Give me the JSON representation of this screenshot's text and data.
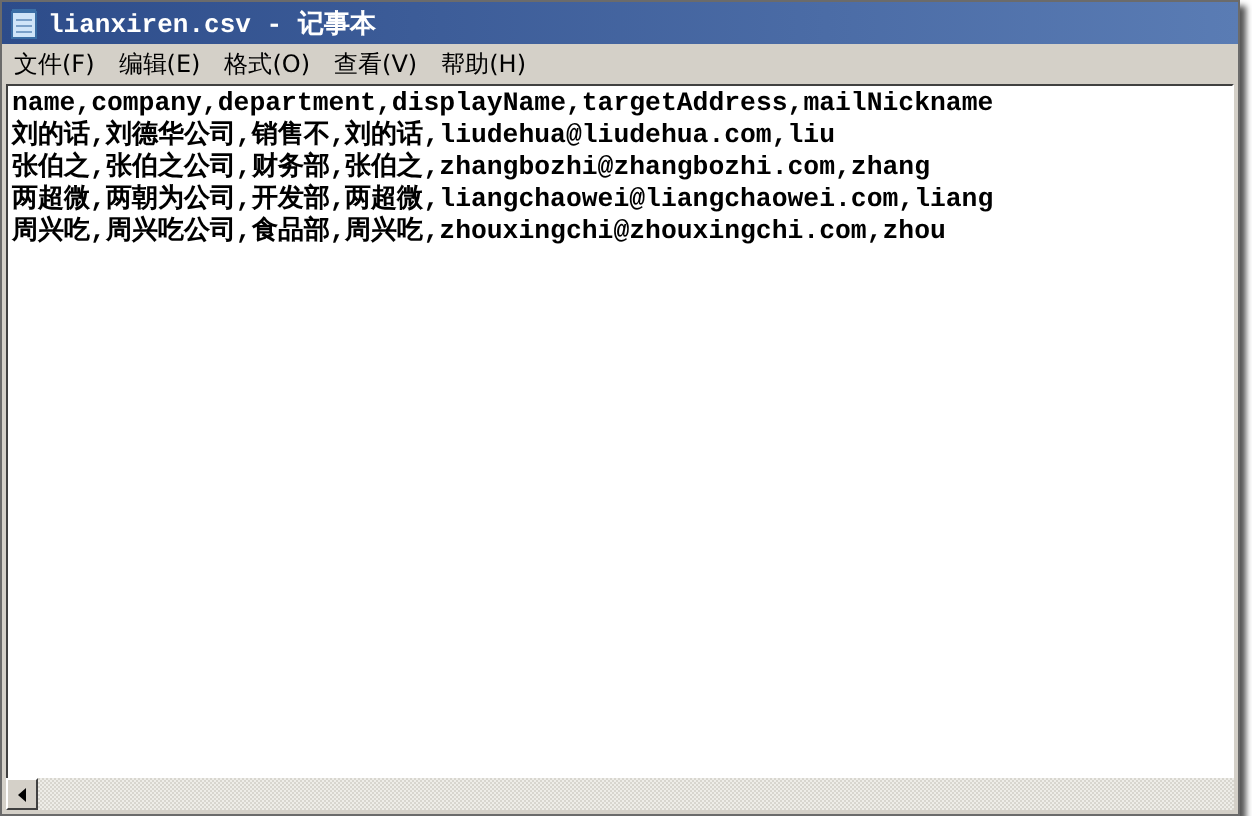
{
  "window": {
    "title": "lianxiren.csv - 记事本"
  },
  "menu": [
    {
      "label": "文件(F)"
    },
    {
      "label": "编辑(E)"
    },
    {
      "label": "格式(O)"
    },
    {
      "label": "查看(V)"
    },
    {
      "label": "帮助(H)"
    }
  ],
  "document": {
    "lines": [
      "name,company,department,displayName,targetAddress,mailNickname",
      "刘的话,刘德华公司,销售不,刘的话,liudehua@liudehua.com,liu",
      "张伯之,张伯之公司,财务部,张伯之,zhangbozhi@zhangbozhi.com,zhang",
      "两超微,两朝为公司,开发部,两超微,liangchaowei@liangchaowei.com,liang",
      "周兴吃,周兴吃公司,食品部,周兴吃,zhouxingchi@zhouxingchi.com,zhou"
    ]
  }
}
